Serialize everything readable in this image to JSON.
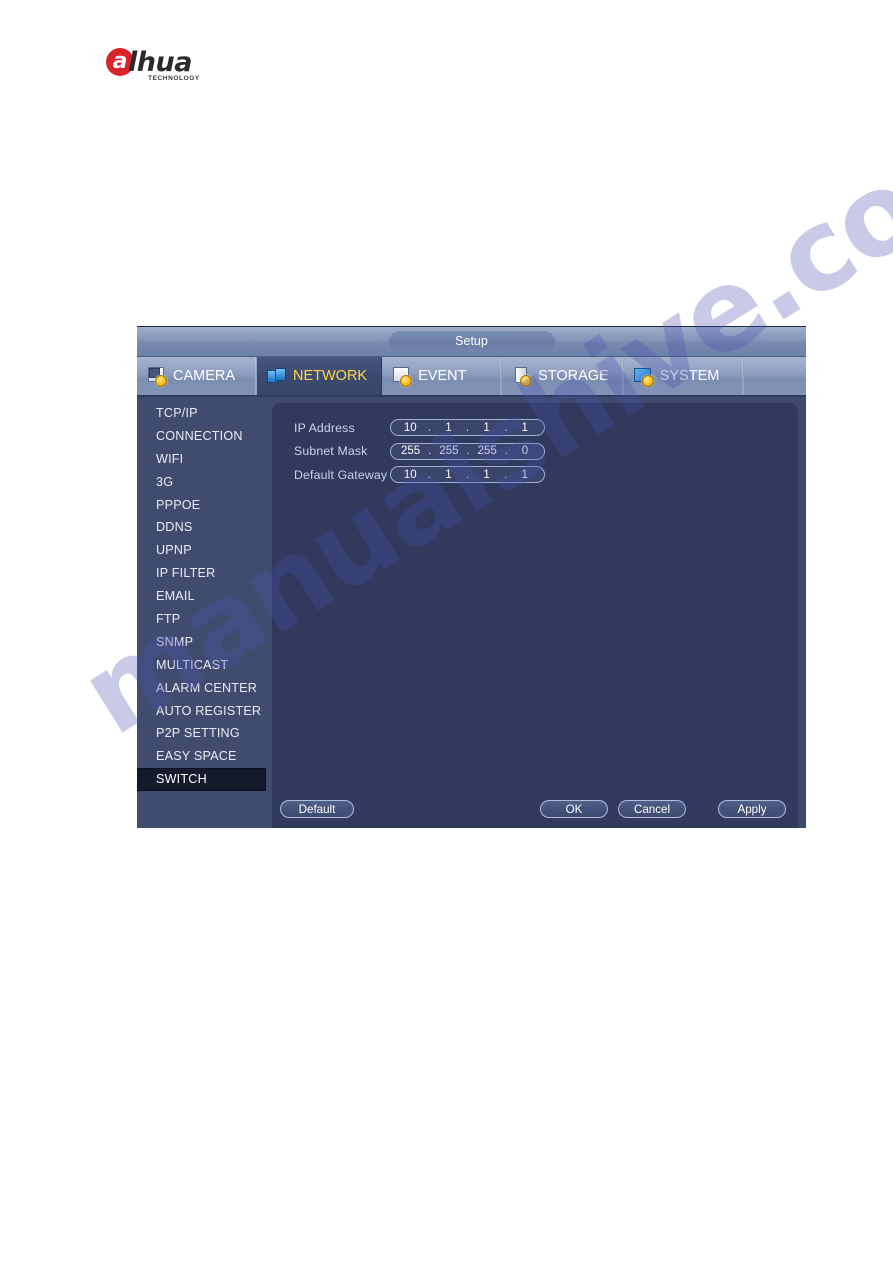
{
  "brand": {
    "mark_letter": "a",
    "word": "lhua",
    "tagline": "TECHNOLOGY"
  },
  "watermark": {
    "text": "manualshive.com"
  },
  "dialog": {
    "title": "Setup",
    "tabs": [
      {
        "label": "CAMERA",
        "icon": "camera-icon",
        "active": false
      },
      {
        "label": "NETWORK",
        "icon": "network-icon",
        "active": true
      },
      {
        "label": "EVENT",
        "icon": "event-icon",
        "active": false
      },
      {
        "label": "STORAGE",
        "icon": "storage-icon",
        "active": false
      },
      {
        "label": "SYSTEM",
        "icon": "system-icon",
        "active": false
      }
    ],
    "sidebar": {
      "items": [
        {
          "label": "TCP/IP",
          "active": false
        },
        {
          "label": "CONNECTION",
          "active": false
        },
        {
          "label": "WIFI",
          "active": false
        },
        {
          "label": "3G",
          "active": false
        },
        {
          "label": "PPPOE",
          "active": false
        },
        {
          "label": "DDNS",
          "active": false
        },
        {
          "label": "UPNP",
          "active": false
        },
        {
          "label": "IP FILTER",
          "active": false
        },
        {
          "label": "EMAIL",
          "active": false
        },
        {
          "label": "FTP",
          "active": false
        },
        {
          "label": "SNMP",
          "active": false
        },
        {
          "label": "MULTICAST",
          "active": false
        },
        {
          "label": "ALARM CENTER",
          "active": false
        },
        {
          "label": "AUTO REGISTER",
          "active": false
        },
        {
          "label": "P2P SETTING",
          "active": false
        },
        {
          "label": "EASY SPACE",
          "active": false
        },
        {
          "label": "SWITCH",
          "active": true
        }
      ]
    },
    "form": {
      "fields": [
        {
          "label": "IP Address",
          "octets": [
            "10",
            "1",
            "1",
            "1"
          ]
        },
        {
          "label": "Subnet Mask",
          "octets": [
            "255",
            "255",
            "255",
            "0"
          ]
        },
        {
          "label": "Default Gateway",
          "octets": [
            "10",
            "1",
            "1",
            "1"
          ]
        }
      ],
      "separator": "."
    },
    "buttons": {
      "default": "Default",
      "ok": "OK",
      "cancel": "Cancel",
      "apply": "Apply"
    },
    "colors": {
      "accent_active_tab_text": "#ffd843",
      "panel_bg": "#2f3a5c",
      "sidebar_bg": "#3f4c6e",
      "sidebar_active_bg": "#14192b",
      "brand_red": "#d8232a"
    }
  }
}
